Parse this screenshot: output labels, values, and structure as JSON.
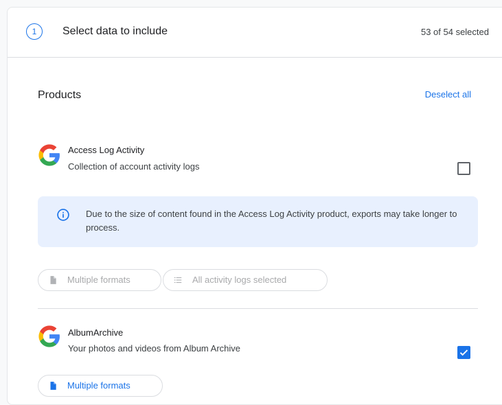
{
  "step": {
    "number": "1",
    "title": "Select data to include",
    "count": "53 of 54 selected"
  },
  "products_section": {
    "label": "Products",
    "deselect_label": "Deselect all"
  },
  "products": [
    {
      "name": "Access Log Activity",
      "description": "Collection of account activity logs",
      "checked": false,
      "info": "Due to the size of content found in the Access Log Activity product, exports may take longer to process.",
      "chips": [
        "Multiple formats",
        "All activity logs selected"
      ]
    },
    {
      "name": "AlbumArchive",
      "description": "Your photos and videos from Album Archive",
      "checked": true,
      "chips": [
        "Multiple formats"
      ]
    }
  ],
  "colors": {
    "accent": "#1a73e8",
    "info_bg": "#e8f0fe",
    "divider": "#dadce0"
  },
  "icons": {
    "product_logo": "google-g-icon",
    "info": "info-icon",
    "file": "file-icon",
    "list": "list-icon",
    "check": "check-icon"
  }
}
